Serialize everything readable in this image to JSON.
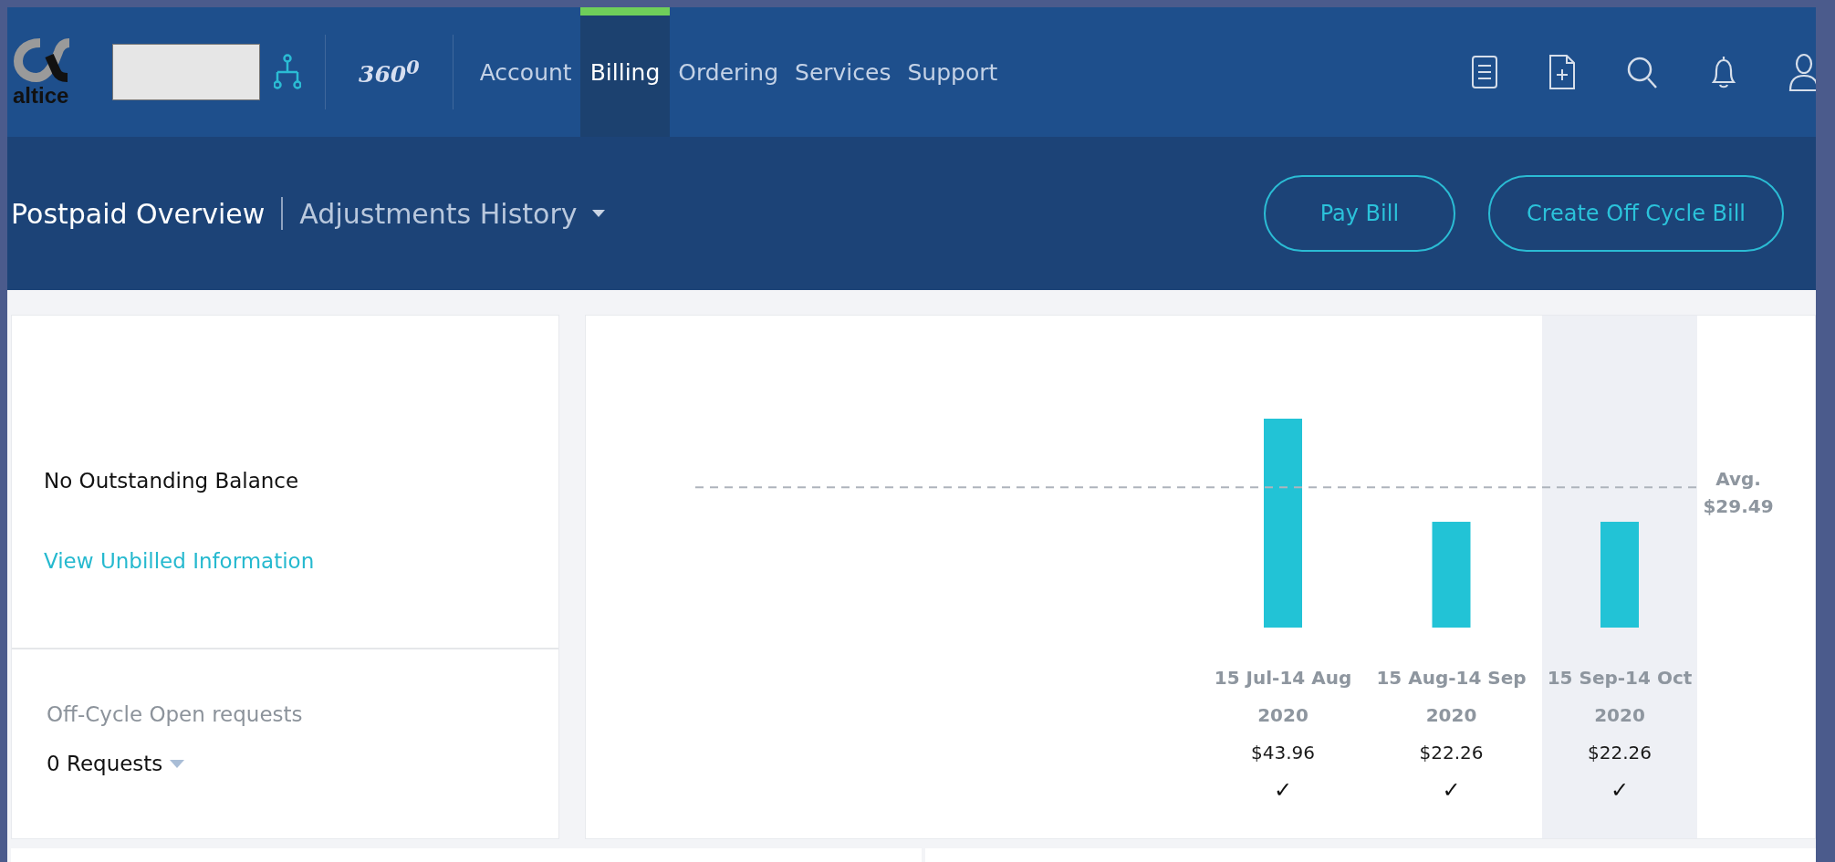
{
  "brand": {
    "name": "altice"
  },
  "header": {
    "product": "360$^{0}$"
  },
  "nav_tabs": [
    {
      "label": "Account",
      "selected": false
    },
    {
      "label": "Billing",
      "selected": true
    },
    {
      "label": "Ordering",
      "selected": false
    },
    {
      "label": "Services",
      "selected": false
    },
    {
      "label": "Support",
      "selected": false
    }
  ],
  "view_tabs": [
    {
      "label": "Postpaid Overview",
      "selected": true,
      "dropdown": false
    },
    {
      "label": "Adjustments History",
      "selected": false,
      "dropdown": true
    }
  ],
  "actions": [
    "Pay Bill",
    "Create Off Cycle Bill"
  ],
  "balance": {
    "status": "No Outstanding Balance",
    "link": "View Unbilled Information"
  },
  "off_cycle": {
    "title": "Off-Cycle Open requests",
    "count": "0 Requests"
  },
  "billing_chart": {
    "average": {
      "label": "Avg.",
      "amount": "$29.49"
    },
    "periods": [
      {
        "period": "15 Jul-14 Aug",
        "year": "2020",
        "amount": "$43.96",
        "selected": false,
        "mark": "✓"
      },
      {
        "period": "15 Aug-14 Sep",
        "year": "2020",
        "amount": "$22.26",
        "selected": false,
        "mark": "✓"
      },
      {
        "period": "15 Sep-14 Oct",
        "year": "2020",
        "amount": "$22.26",
        "selected": true,
        "mark": "✓"
      }
    ]
  }
}
